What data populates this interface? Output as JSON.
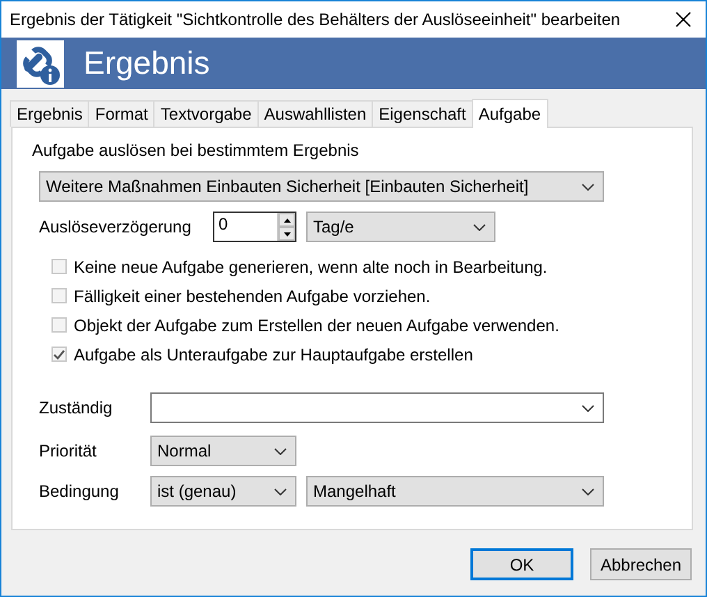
{
  "window": {
    "title": "Ergebnis der Tätigkeit \"Sichtkontrolle des Behälters der Auslöseeinheit\" bearbeiten"
  },
  "header": {
    "title": "Ergebnis"
  },
  "tabs": [
    {
      "label": "Ergebnis",
      "selected": false
    },
    {
      "label": "Format",
      "selected": false
    },
    {
      "label": "Textvorgabe",
      "selected": false
    },
    {
      "label": "Auswahllisten",
      "selected": false
    },
    {
      "label": "Eigenschaft",
      "selected": false
    },
    {
      "label": "Aufgabe",
      "selected": true
    }
  ],
  "trigger": {
    "heading": "Aufgabe auslösen bei bestimmtem Ergebnis",
    "result": "Weitere Maßnahmen Einbauten Sicherheit [Einbauten Sicherheit]",
    "delay": {
      "label": "Auslöseverzögerung",
      "value": "0",
      "unit": "Tag/e"
    },
    "options": [
      {
        "label": "Keine neue Aufgabe generieren, wenn alte noch in Bearbeitung.",
        "checked": false
      },
      {
        "label": "Fälligkeit einer bestehenden Aufgabe vorziehen.",
        "checked": false
      },
      {
        "label": "Objekt der Aufgabe zum Erstellen der neuen Aufgabe verwenden.",
        "checked": false
      },
      {
        "label": "Aufgabe als Unteraufgabe zur Hauptaufgabe erstellen",
        "checked": true
      }
    ]
  },
  "assignment": {
    "responsible": {
      "label": "Zuständig"
    },
    "priority": {
      "label": "Priorität",
      "value": "Normal"
    },
    "condition": {
      "label": "Bedingung",
      "operator": "ist (genau)",
      "value": "Mangelhaft"
    }
  },
  "buttons": [
    {
      "label": "OK",
      "default": true
    },
    {
      "label": "Abbrechen",
      "default": false
    }
  ]
}
